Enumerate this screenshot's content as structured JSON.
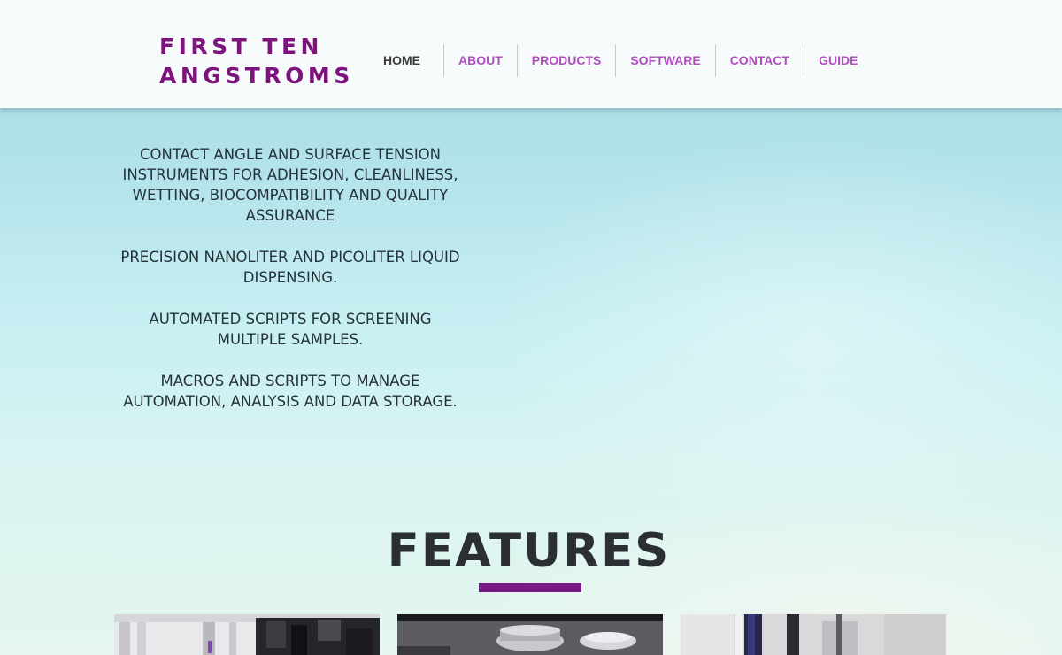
{
  "header": {
    "logo_line1": "FIRST TEN",
    "logo_line2": "ANGSTROMS",
    "nav": [
      {
        "label": "HOME"
      },
      {
        "label": "ABOUT"
      },
      {
        "label": "PRODUCTS"
      },
      {
        "label": "SOFTWARE"
      },
      {
        "label": "CONTACT"
      },
      {
        "label": "GUIDE"
      }
    ]
  },
  "intro": {
    "paragraphs": [
      "CONTACT ANGLE AND SURFACE TENSION INSTRUMENTS FOR ADHESION, CLEANLINESS, WETTING, BIOCOMPATIBILITY AND QUALITY ASSURANCE",
      "PRECISION NANOLITER AND PICOLITER LIQUID DISPENSING.",
      "AUTOMATED SCRIPTS FOR SCREENING MULTIPLE SAMPLES.",
      "MACROS AND SCRIPTS TO MANAGE AUTOMATION, ANALYSIS AND DATA STORAGE."
    ]
  },
  "features": {
    "title": "FEATURES"
  },
  "colors": {
    "brand": "#7d137d",
    "nav_link": "#b34bc1",
    "nav_active": "#3a3a3a",
    "underline": "#7a1a86"
  }
}
